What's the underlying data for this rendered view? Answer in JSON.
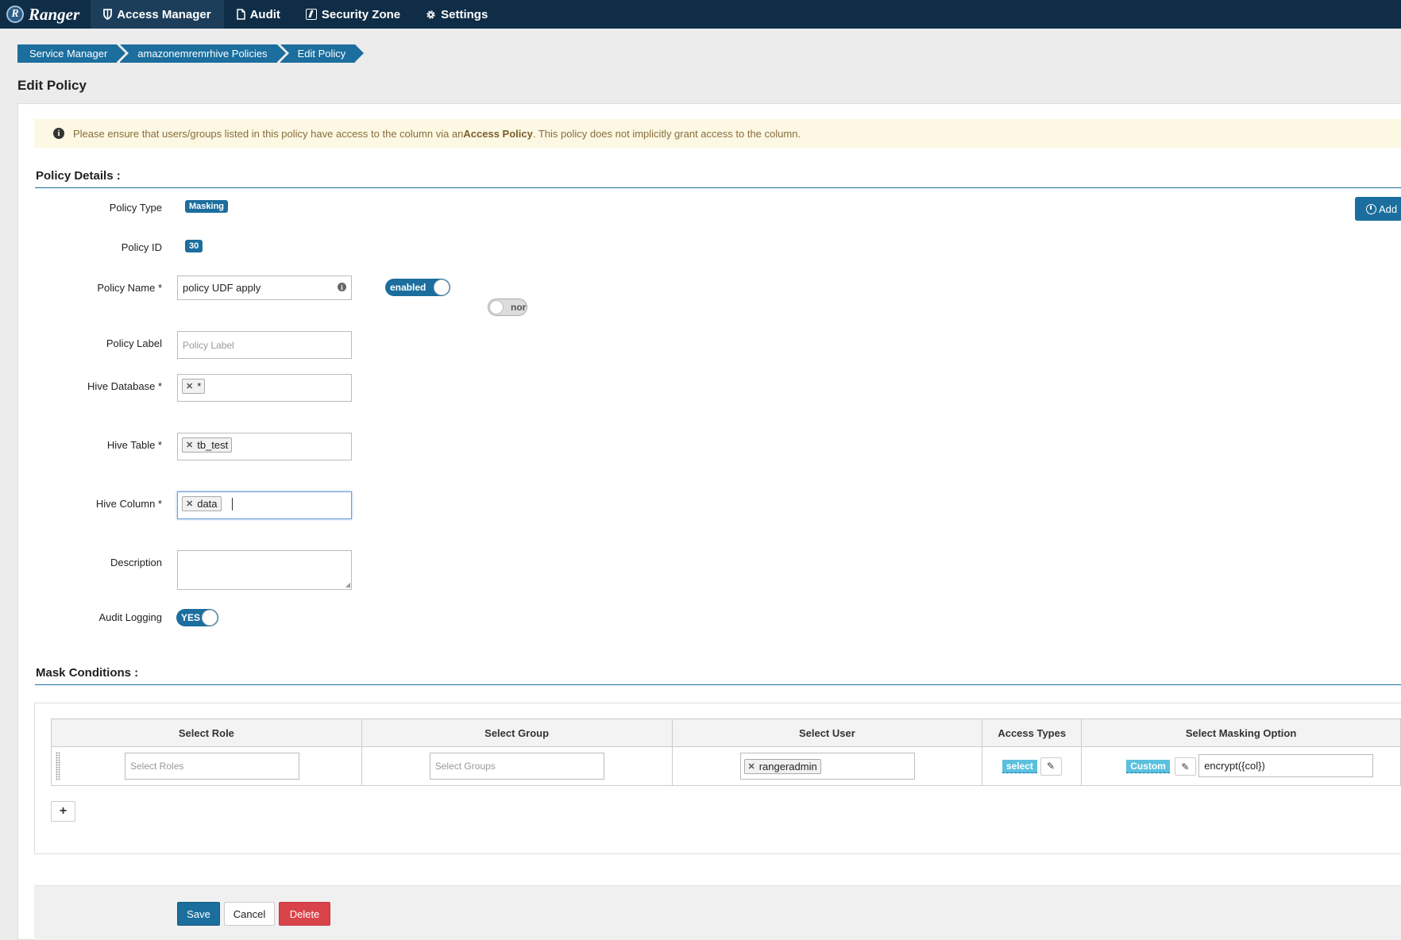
{
  "nav": {
    "brand": "Ranger",
    "logo_letter": "R",
    "items": [
      {
        "label": "Access Manager",
        "icon": "shield-icon"
      },
      {
        "label": "Audit",
        "icon": "file-icon"
      },
      {
        "label": "Security Zone",
        "icon": "lightning-box-icon"
      },
      {
        "label": "Settings",
        "icon": "gear-icon"
      }
    ]
  },
  "breadcrumb": [
    "Service Manager",
    "amazonemremrhive Policies",
    "Edit Policy"
  ],
  "page_title": "Edit Policy",
  "alert": {
    "text_before": "Please ensure that users/groups listed in this policy have access to the column via an ",
    "bold": "Access Policy",
    "text_after": ". This policy does not implicitly grant access to the column."
  },
  "policy_details": {
    "heading": "Policy Details :",
    "add_button": "Add",
    "policy_type_label": "Policy Type",
    "policy_type": "Masking",
    "policy_id_label": "Policy ID",
    "policy_id": "30",
    "policy_name_label": "Policy Name *",
    "policy_name": "policy UDF apply",
    "enabled_toggle": "enabled",
    "normal_toggle": "normal",
    "policy_label_label": "Policy Label",
    "policy_label_placeholder": "Policy Label",
    "hive_database_label": "Hive Database *",
    "hive_database_tag": "*",
    "hive_table_label": "Hive Table *",
    "hive_table_tag": "tb_test",
    "hive_column_label": "Hive Column *",
    "hive_column_tag": "data",
    "description_label": "Description",
    "audit_logging_label": "Audit Logging",
    "audit_logging_toggle": "YES"
  },
  "mask_conditions": {
    "heading": "Mask Conditions :",
    "columns": [
      "Select Role",
      "Select Group",
      "Select User",
      "Access Types",
      "Select Masking Option"
    ],
    "row": {
      "role_placeholder": "Select Roles",
      "group_placeholder": "Select Groups",
      "user_tag": "rangeradmin",
      "access_type": "select",
      "masking_option": "Custom",
      "masking_value": "encrypt({col})"
    }
  },
  "footer": {
    "save": "Save",
    "cancel": "Cancel",
    "delete": "Delete"
  }
}
